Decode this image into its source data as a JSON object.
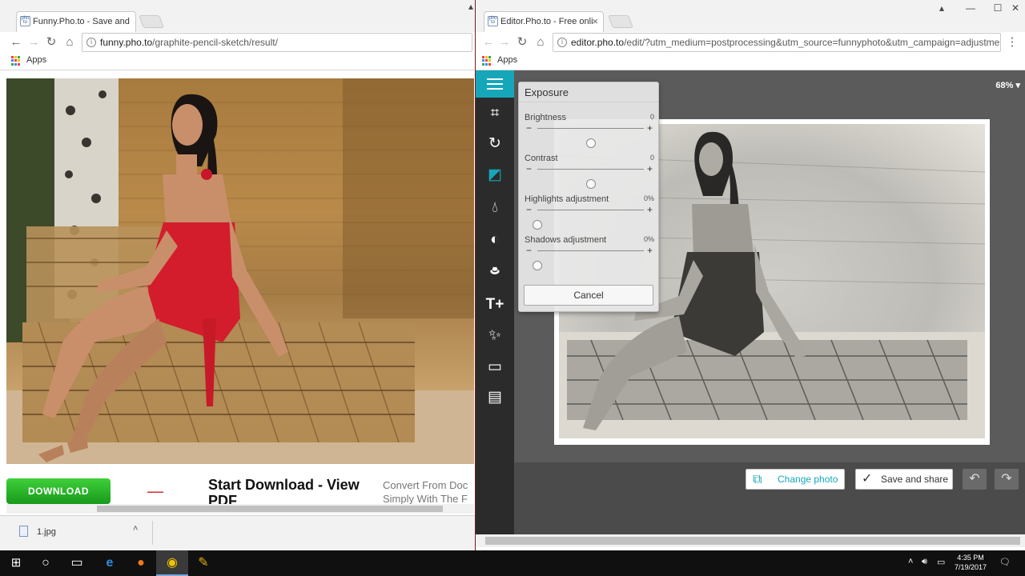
{
  "left_window": {
    "tab_title": "Funny.Pho.to - Save and",
    "url_host": "funny.pho.to",
    "url_path": "/graphite-pencil-sketch/result/",
    "bookmarks_apps": "Apps",
    "ad": {
      "download_label": "DOWNLOAD",
      "headline": "Start Download - View PDF",
      "subtext": "Convert From Doc Simply With The F"
    },
    "download_file": "1.jpg"
  },
  "right_window": {
    "tab_title": "Editor.Pho.to - Free onli",
    "url_host": "editor.pho.to",
    "url_path": "/edit/?utm_medium=postprocessing&utm_source=funnyphoto&utm_campaign=adjustments&i",
    "bookmarks_apps": "Apps",
    "zoom": "68% ▾",
    "panel": {
      "title": "Exposure",
      "sliders": [
        {
          "label": "Brightness",
          "value": "0",
          "level": 0.5
        },
        {
          "label": "Contrast",
          "value": "0",
          "level": 0.5
        },
        {
          "label": "Highlights adjustment",
          "value": "0%",
          "level": 0.0
        },
        {
          "label": "Shadows adjustment",
          "value": "0%",
          "level": 0.0
        }
      ],
      "cancel_label": "Cancel"
    },
    "change_photo_label": "Change photo",
    "save_share_label": "Save and share",
    "undo_icon": "undo-icon",
    "redo_icon": "redo-icon",
    "accent_color": "#16a6b9"
  },
  "taskbar": {
    "time": "4:35 PM",
    "date": "7/19/2017"
  }
}
